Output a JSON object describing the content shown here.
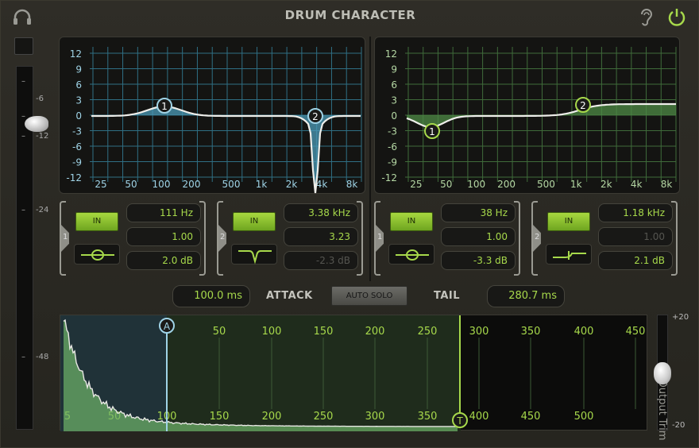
{
  "app": {
    "title": "DRUM CHARACTER"
  },
  "icons": {
    "headphones": "headphones-icon",
    "ear": "ear-icon",
    "power": "power-icon"
  },
  "colors": {
    "accent_green": "#a7d94b",
    "blue_curve": "#7fc3dd",
    "green_fill": "#5a9a50"
  },
  "input_meter": {
    "scale": [
      "-6",
      "-12",
      "-24",
      "-48"
    ],
    "level_fraction": 0.17
  },
  "eq_left": {
    "y_ticks": [
      "12",
      "9",
      "6",
      "3",
      "0",
      "-3",
      "-6",
      "-9",
      "-12"
    ],
    "x_ticks": [
      "25",
      "50",
      "100",
      "200",
      "500",
      "1k",
      "2k",
      "4k",
      "8k"
    ],
    "nodes": [
      "1",
      "2"
    ],
    "bands": [
      {
        "num": "1",
        "in_label": "IN",
        "freq": "111 Hz",
        "q": "1.00",
        "gain": "2.0 dB",
        "shape": "bell",
        "q_dim": false,
        "gain_dim": false
      },
      {
        "num": "2",
        "in_label": "IN",
        "freq": "3.38 kHz",
        "q": "3.23",
        "gain": "-2.3 dB",
        "shape": "notch",
        "q_dim": false,
        "gain_dim": true
      }
    ]
  },
  "eq_right": {
    "y_ticks": [
      "12",
      "9",
      "6",
      "3",
      "0",
      "-3",
      "-6",
      "-9",
      "-12"
    ],
    "x_ticks": [
      "25",
      "50",
      "100",
      "200",
      "500",
      "1k",
      "2k",
      "4k",
      "8k"
    ],
    "nodes": [
      "1",
      "2"
    ],
    "bands": [
      {
        "num": "1",
        "in_label": "IN",
        "freq": "38 Hz",
        "q": "1.00",
        "gain": "-3.3 dB",
        "shape": "bell",
        "q_dim": false,
        "gain_dim": false
      },
      {
        "num": "2",
        "in_label": "IN",
        "freq": "1.18 kHz",
        "q": "1.00",
        "gain": "2.1 dB",
        "shape": "shelf",
        "q_dim": true,
        "gain_dim": false
      }
    ]
  },
  "attack": {
    "value": "100.0 ms",
    "label": "ATTACK"
  },
  "auto_solo": {
    "label": "AUTO SOLO"
  },
  "tail": {
    "value": "280.7 ms",
    "label": "TAIL"
  },
  "transient": {
    "top_ticks": [
      "50",
      "100",
      "150",
      "200",
      "250",
      "300",
      "350",
      "400",
      "450"
    ],
    "bottom_ticks": [
      "5",
      "50",
      "100",
      "150",
      "200",
      "250",
      "300",
      "350",
      "400",
      "450",
      "500"
    ],
    "marker_a": "A",
    "marker_t": "T"
  },
  "output_trim": {
    "label": "Output Trim",
    "max": "+20",
    "min": "-20"
  }
}
